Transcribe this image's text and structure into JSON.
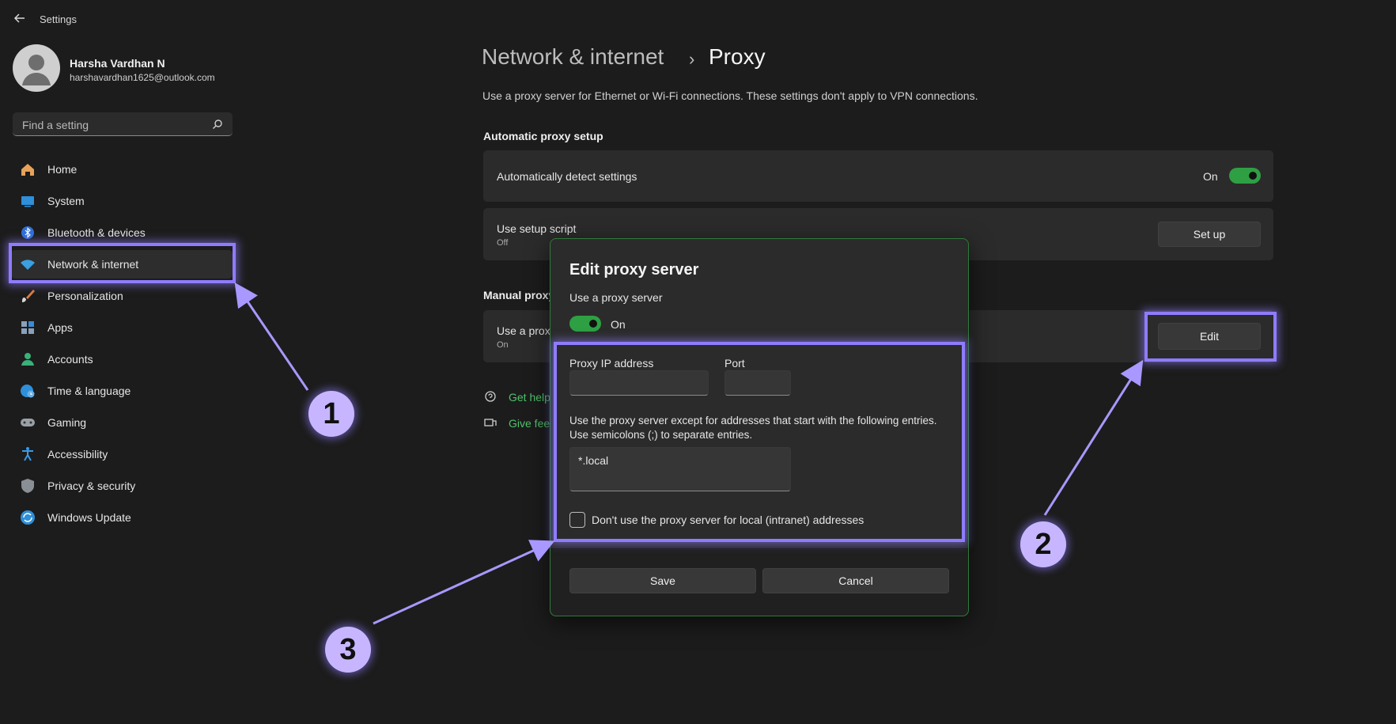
{
  "window": {
    "title": "Settings"
  },
  "profile": {
    "name": "Harsha Vardhan N",
    "email": "harshavardhan1625@outlook.com"
  },
  "search": {
    "placeholder": "Find a setting"
  },
  "sidebar": {
    "items": [
      {
        "label": "Home",
        "icon": "home-icon"
      },
      {
        "label": "System",
        "icon": "system-icon"
      },
      {
        "label": "Bluetooth & devices",
        "icon": "bluetooth-icon"
      },
      {
        "label": "Network & internet",
        "icon": "wifi-icon",
        "active": true
      },
      {
        "label": "Personalization",
        "icon": "brush-icon"
      },
      {
        "label": "Apps",
        "icon": "apps-icon"
      },
      {
        "label": "Accounts",
        "icon": "account-icon"
      },
      {
        "label": "Time & language",
        "icon": "globe-clock-icon"
      },
      {
        "label": "Gaming",
        "icon": "gamepad-icon"
      },
      {
        "label": "Accessibility",
        "icon": "accessibility-icon"
      },
      {
        "label": "Privacy & security",
        "icon": "shield-icon"
      },
      {
        "label": "Windows Update",
        "icon": "update-icon"
      }
    ]
  },
  "header": {
    "breadcrumb_parent": "Network & internet",
    "separator": "›",
    "breadcrumb_current": "Proxy",
    "description": "Use a proxy server for Ethernet or Wi-Fi connections. These settings don't apply to VPN connections."
  },
  "auto_setup": {
    "heading": "Automatic proxy setup",
    "detect": {
      "label": "Automatically detect settings",
      "state": "On"
    },
    "script": {
      "label": "Use setup script",
      "state": "Off",
      "button": "Set up"
    }
  },
  "manual": {
    "heading": "Manual proxy setup",
    "row_label": "Use a proxy server",
    "row_state": "On",
    "edit_button": "Edit"
  },
  "links": {
    "help": "Get help",
    "feedback": "Give feedback"
  },
  "dialog": {
    "title": "Edit proxy server",
    "use_proxy_label": "Use a proxy server",
    "toggle_state": "On",
    "ip_label": "Proxy IP address",
    "ip_value": "",
    "port_label": "Port",
    "port_value": "",
    "exceptions_text_1": "Use the proxy server except for addresses that start with the following entries.",
    "exceptions_text_2": "Use semicolons (;) to separate entries.",
    "exceptions_value": "*.local",
    "local_checkbox_label": "Don't use the proxy server for local (intranet) addresses",
    "save": "Save",
    "cancel": "Cancel"
  },
  "annotations": {
    "one": "1",
    "two": "2",
    "three": "3"
  },
  "colors": {
    "accent_green": "#2ea043",
    "highlight": "#8e7cff",
    "badge": "#c7b6ff"
  }
}
